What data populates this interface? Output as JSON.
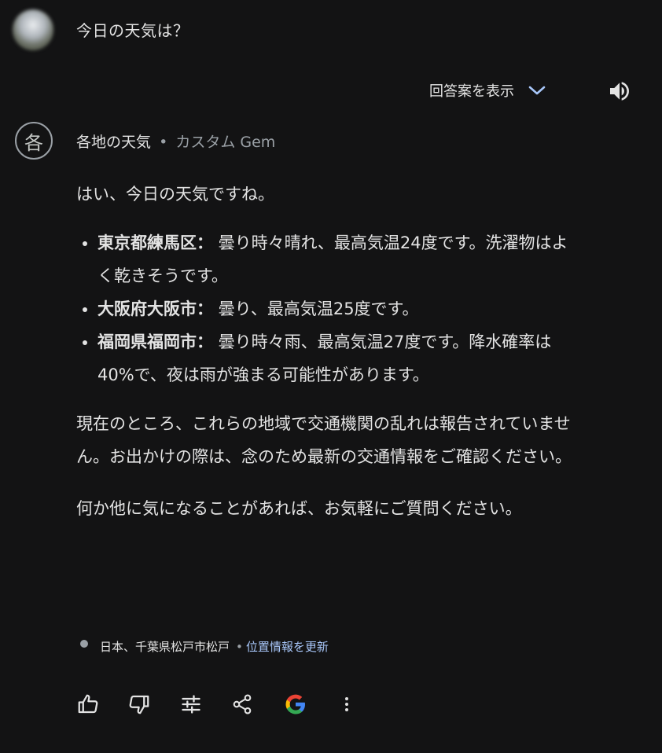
{
  "user": {
    "query": "今日の天気は？"
  },
  "toolbar": {
    "drafts_label": "回答案を表示"
  },
  "gem": {
    "avatar_char": "各",
    "name": "各地の天気",
    "separator": "•",
    "type": "カスタム Gem"
  },
  "response": {
    "intro": "はい、今日の天気ですね。",
    "items": [
      {
        "place": "東京都練馬区：",
        "text": " 曇り時々晴れ、最高気温24度です。洗濯物はよく乾きそうです。"
      },
      {
        "place": "大阪府大阪市：",
        "text": " 曇り、最高気温25度です。"
      },
      {
        "place": "福岡県福岡市：",
        "text": " 曇り時々雨、最高気温27度です。降水確率は40%で、夜は雨が強まる可能性があります。"
      }
    ],
    "traffic": "現在のところ、これらの地域で交通機関の乱れは報告されていません。お出かけの際は、念のため最新の交通情報をご確認ください。",
    "closing": "何か他に気になることがあれば、お気軽にご質問ください。"
  },
  "location": {
    "text": "日本、千葉県松戸市松戸",
    "separator": "•",
    "update_link": "位置情報を更新"
  },
  "colors": {
    "background": "#131314",
    "text": "#e3e3e3",
    "muted": "#9aa0a6",
    "link": "#a8c7fa",
    "chevron": "#a8c7fa"
  },
  "icons": [
    "user-avatar",
    "chevron-down-icon",
    "speaker-icon",
    "thumbs-up-icon",
    "thumbs-down-icon",
    "tune-icon",
    "share-icon",
    "google-icon",
    "more-vert-icon"
  ]
}
